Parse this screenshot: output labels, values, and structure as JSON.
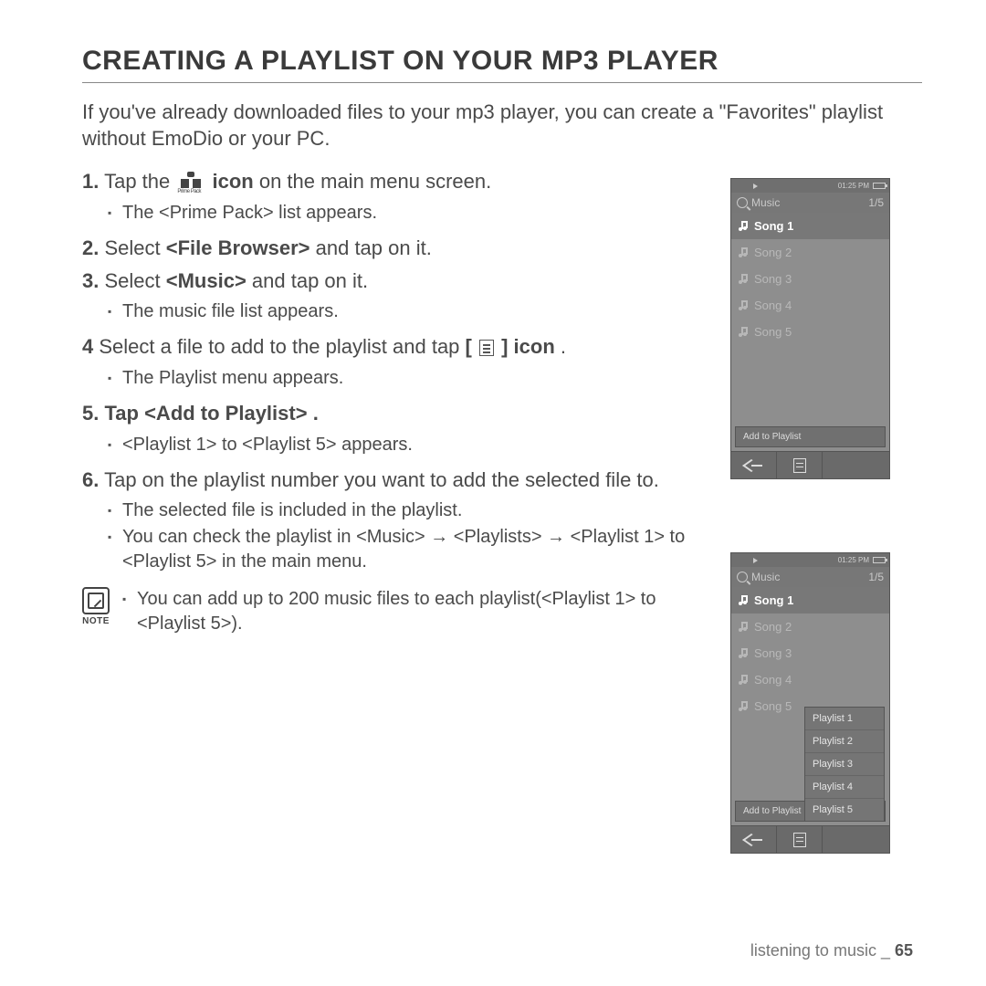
{
  "title": "CREATING A PLAYLIST ON YOUR MP3 PLAYER",
  "intro": "If you've already downloaded files to your mp3 player, you can create a \"Favorites\" playlist without EmoDio or your PC.",
  "step1": {
    "num": "1.",
    "a": "Tap the ",
    "b": " icon",
    "c": " on the main menu screen."
  },
  "step1_sub": "The <Prime Pack> list appears.",
  "step2": {
    "num": "2.",
    "a": "Select ",
    "b": "<File Browser>",
    "c": " and tap on it."
  },
  "step3": {
    "num": "3.",
    "a": "Select ",
    "b": "<Music>",
    "c": " and tap on it."
  },
  "step3_sub": "The music file list appears.",
  "step4": {
    "num": "4",
    "a": " Select a file to add to the playlist and tap ",
    "b": "[",
    "c": "] icon",
    "d": "."
  },
  "step4_sub": "The Playlist menu appears.",
  "step5": {
    "num": "5.",
    "a": "Tap ",
    "b": "<Add to Playlist>",
    "c": "."
  },
  "step5_sub": "<Playlist 1> to <Playlist 5> appears.",
  "step6": {
    "num": "6.",
    "a": "Tap on the playlist number you want to add the selected file to."
  },
  "step6_sub1": "The selected file is included in the playlist.",
  "step6_sub2": "You can check the playlist in <Music> → <Playlists> → <Playlist 1> to <Playlist 5> in the main menu.",
  "note": {
    "label": "NOTE",
    "text": "You can add up to 200 music files to each playlist(<Playlist 1> to <Playlist 5>)."
  },
  "primepack_label": "Prime Pack",
  "device": {
    "time": "01:25 PM",
    "header_title": "Music",
    "header_count": "1/5",
    "songs": [
      "Song 1",
      "Song 2",
      "Song 3",
      "Song 4",
      "Song 5"
    ],
    "menu_item": "Add to Playlist",
    "playlists": [
      "Playlist 1",
      "Playlist 2",
      "Playlist 3",
      "Playlist 4",
      "Playlist 5"
    ]
  },
  "footer": {
    "section": "listening to music _ ",
    "page": "65"
  }
}
